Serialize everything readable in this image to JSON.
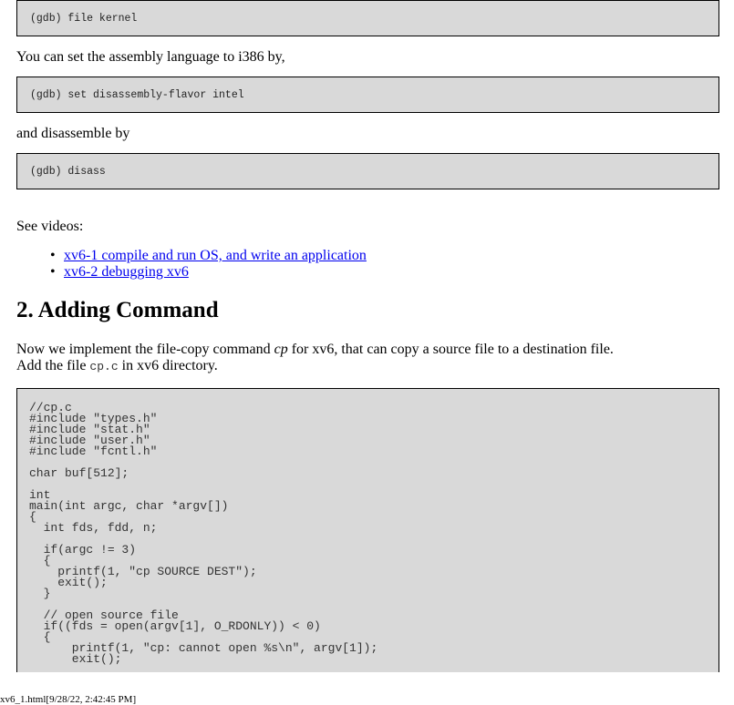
{
  "commands": {
    "file_kernel": "(gdb) file kernel",
    "set_flavor": "(gdb) set disassembly-flavor intel",
    "disass": "(gdb) disass"
  },
  "paragraphs": {
    "set_assembly": "You can set the assembly language to i386 by,",
    "disassemble_by": "and disassemble by",
    "see_videos": "See videos:"
  },
  "videos": [
    "xv6-1 compile and run OS, and write an application",
    "xv6-2 debugging xv6"
  ],
  "section": {
    "heading": "2. Adding Command",
    "intro_before_em": "Now we implement the file-copy command ",
    "intro_em": "cp",
    "intro_after_em": " for xv6, that can copy a source file to a destination file.",
    "add_before": "Add the file ",
    "add_code": "cp.c",
    "add_after": " in xv6 directory."
  },
  "code_lines": [
    "//cp.c",
    "#include \"types.h\"",
    "#include \"stat.h\"",
    "#include \"user.h\"",
    "#include \"fcntl.h\"",
    "",
    "char buf[512];",
    "",
    "int",
    "main(int argc, char *argv[])",
    "{",
    "  int fds, fdd, n;",
    "",
    "  if(argc != 3)",
    "  {",
    "    printf(1, \"cp SOURCE DEST\");",
    "    exit();",
    "  }",
    "",
    "  // open source file",
    "  if((fds = open(argv[1], O_RDONLY)) < 0)",
    "  {",
    "      printf(1, \"cp: cannot open %s\\n\", argv[1]);",
    "      exit();"
  ],
  "footer": "xv6_1.html[9/28/22, 2:42:45 PM]"
}
